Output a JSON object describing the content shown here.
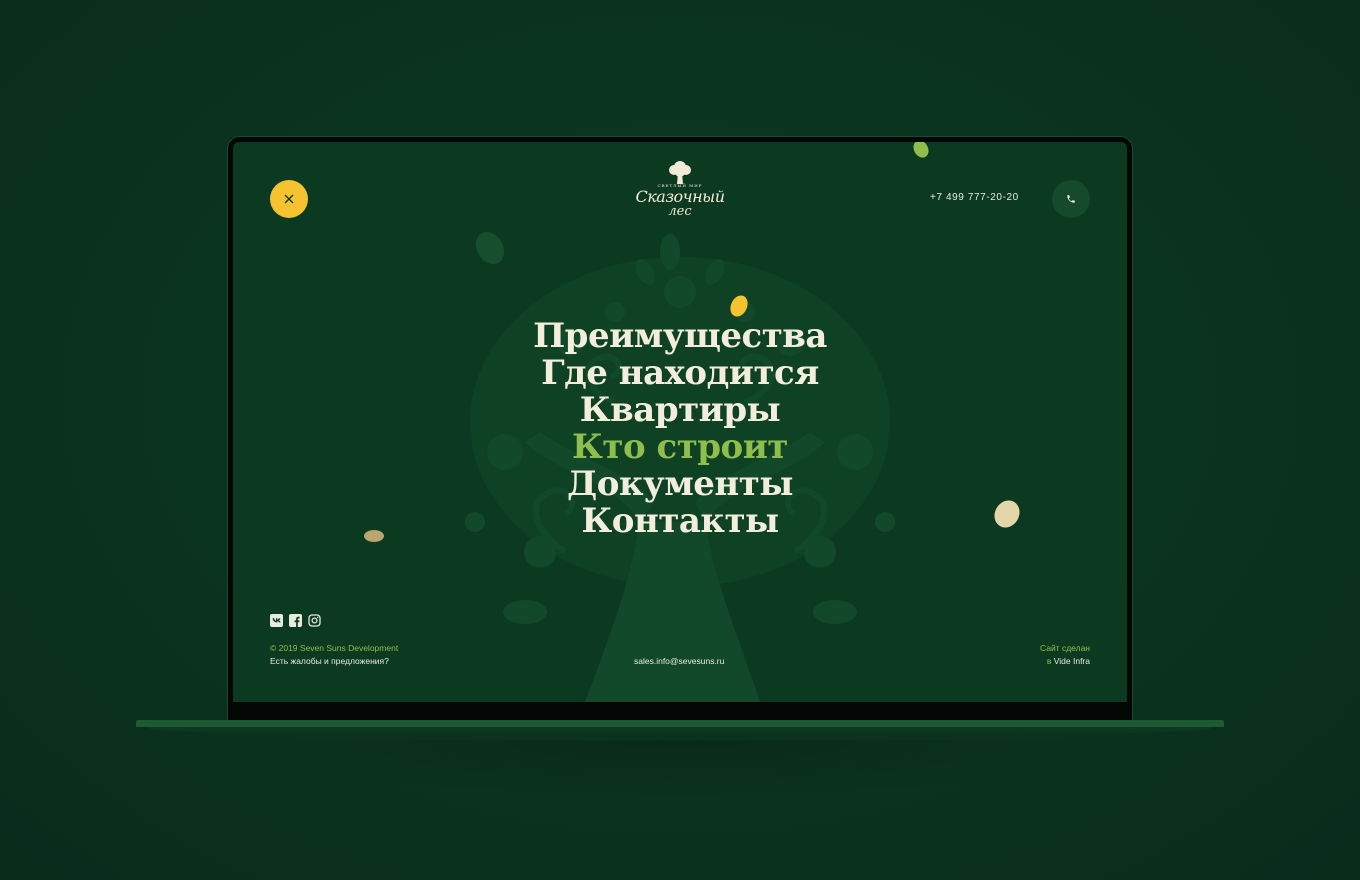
{
  "header": {
    "close_icon": "close-icon",
    "logo": {
      "kicker": "СВЕТЛЫЙ МИР",
      "name_line1": "Сказочный",
      "name_line2": "лес"
    },
    "phone": "+7 499 777-20-20",
    "phone_icon": "phone-icon"
  },
  "menu": {
    "items": [
      {
        "label": "Преимущества"
      },
      {
        "label": "Где находится"
      },
      {
        "label": "Квартиры"
      },
      {
        "label": "Кто строит",
        "active": true
      },
      {
        "label": "Документы"
      },
      {
        "label": "Контакты"
      }
    ]
  },
  "footer": {
    "social": [
      "vk-icon",
      "facebook-icon",
      "instagram-icon"
    ],
    "copyright": "© 2019 Seven Suns Development",
    "complaints": "Есть жалобы и предложения?",
    "email": "sales.info@sevesuns.ru",
    "made_by_label": "Сайт сделан",
    "made_by_prefix": "в",
    "made_by_agency": "Vide Infra"
  },
  "colors": {
    "background": "#0b3320",
    "screen": "#0c3a21",
    "accent_yellow": "#f5c330",
    "accent_green": "#8fbe4c",
    "text_light": "#f3eedc"
  }
}
